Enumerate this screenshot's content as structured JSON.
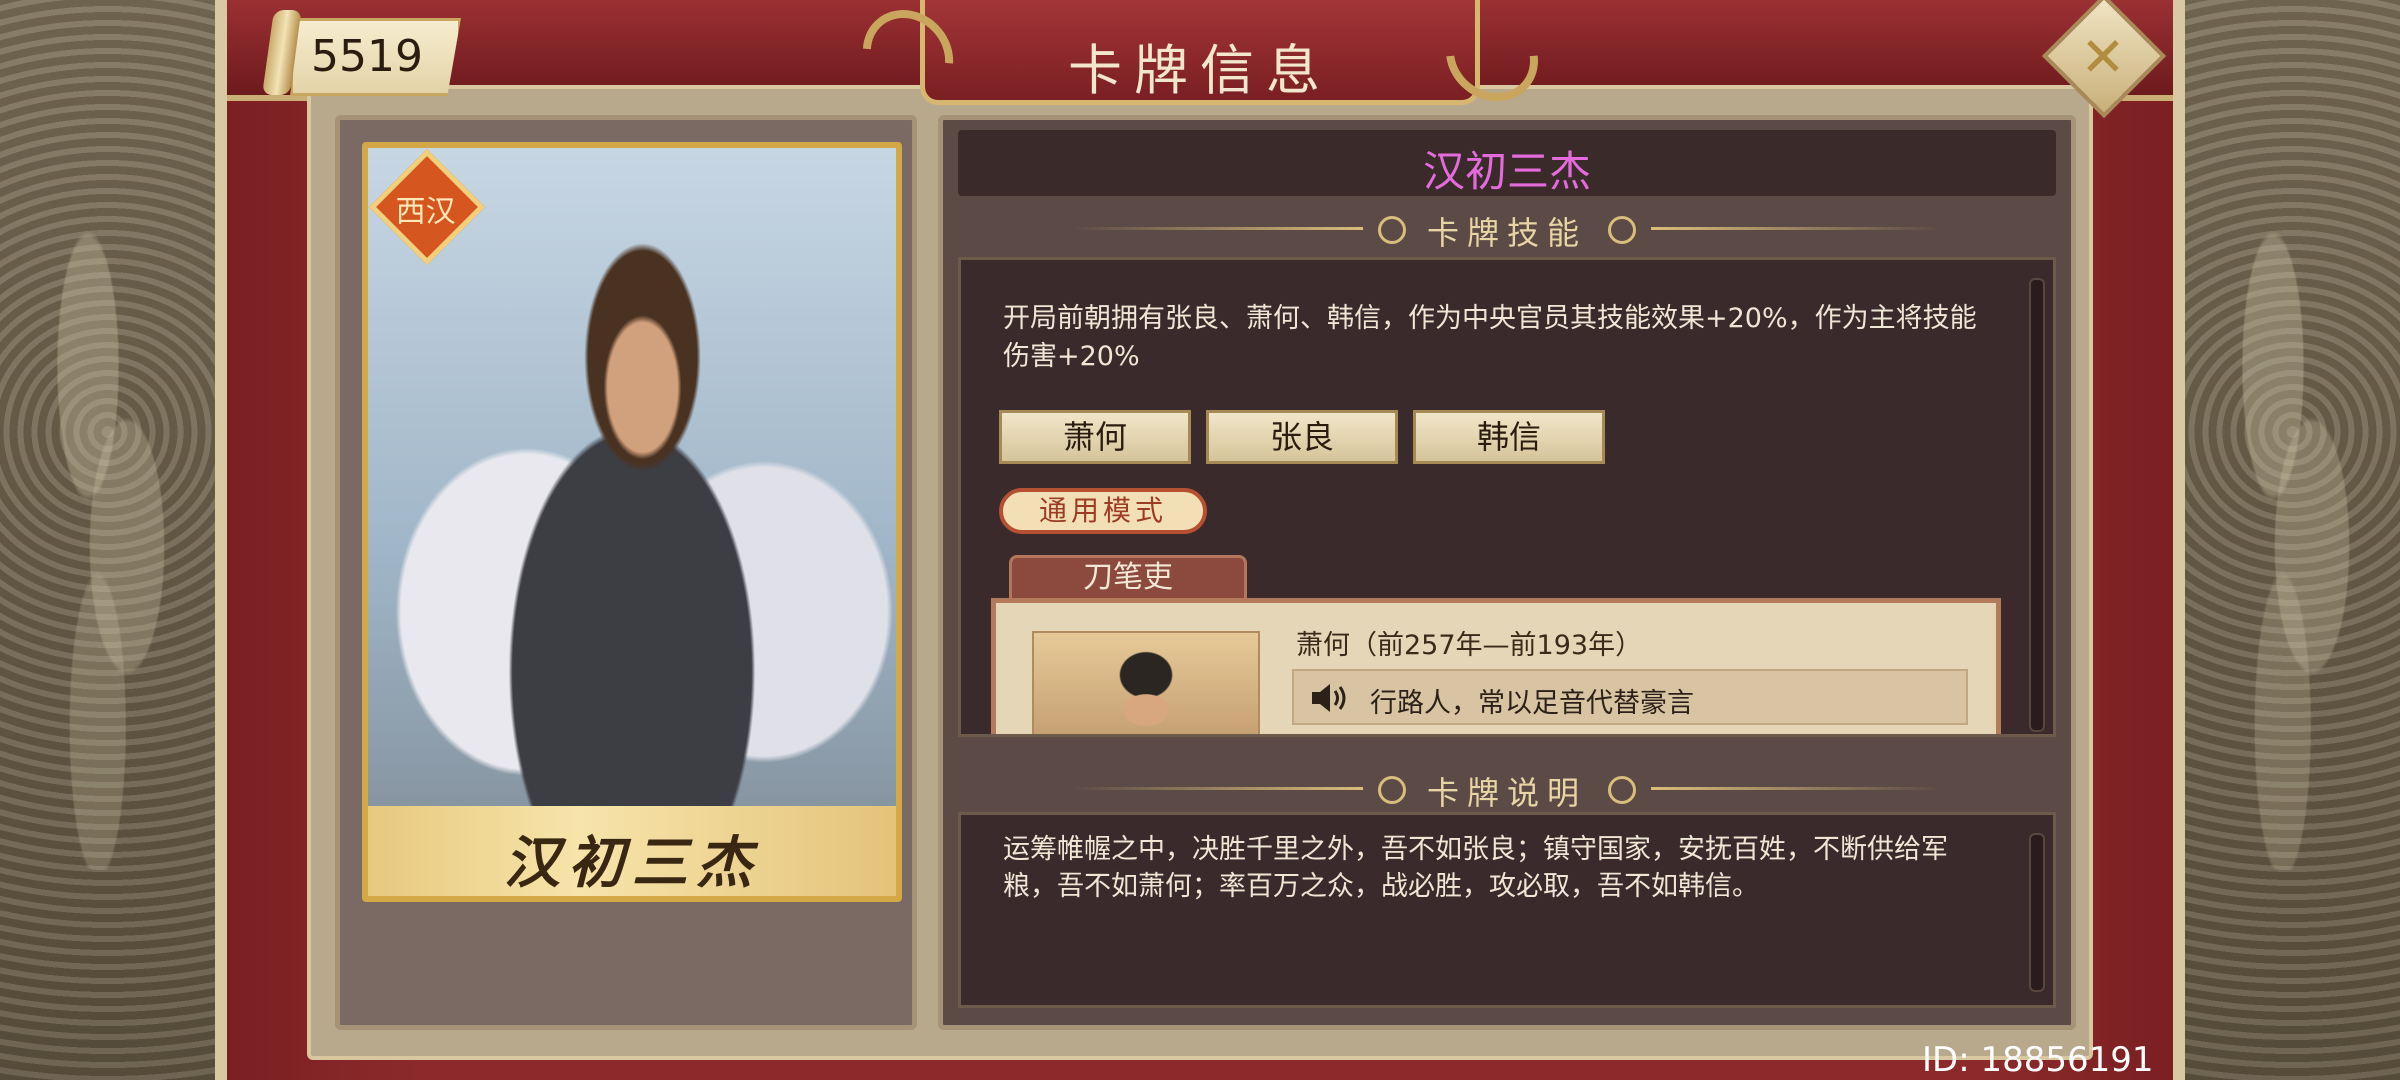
{
  "header": {
    "title": "卡牌信息",
    "score": "5519",
    "close_icon": "close-x-icon"
  },
  "card": {
    "badge": "西汉",
    "name_banner": "汉初三杰"
  },
  "detail": {
    "card_title": "汉初三杰",
    "card_title_color": "#e36bdc",
    "skill_section_label": "卡牌技能",
    "skill_text": "开局前朝拥有张良、萧何、韩信，作为中央官员其技能效果+20%，作为主将技能伤害+20%",
    "generals": [
      "萧何",
      "张良",
      "韩信"
    ],
    "mode_label": "通用模式",
    "char_tab": "刀笔吏",
    "char_name": "萧何（前257年—前193年）",
    "voice_line": "行路人，常以足音代替豪言",
    "desc_section_label": "卡牌说明",
    "desc_text": "运筹帷幄之中，决胜千里之外，吾不如张良；镇守国家，安抚百姓，不断供给军粮，吾不如萧何；率百万之众，战必胜，攻必取，吾不如韩信。"
  },
  "footer": {
    "user_id": "ID: 18856191"
  }
}
